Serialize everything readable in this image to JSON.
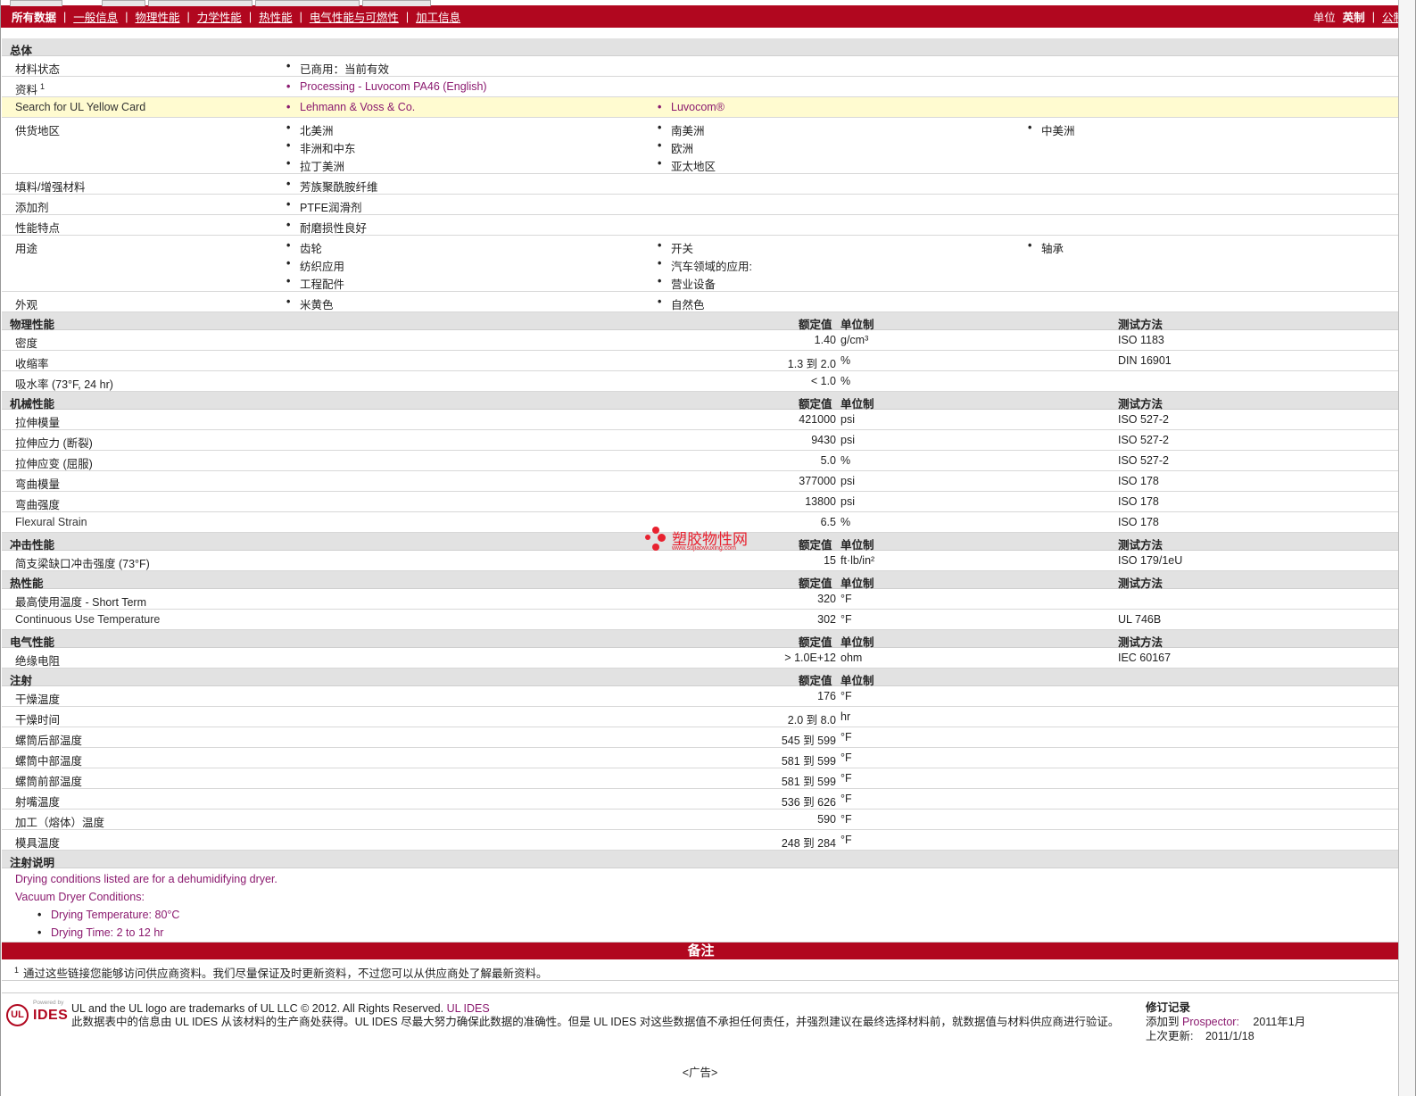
{
  "nav": {
    "all_data": "所有数据",
    "links": [
      "一般信息",
      "物理性能",
      "力学性能",
      "热性能",
      "电气性能与可燃性",
      "加工信息"
    ],
    "units_label": "单位",
    "unit_english": "英制",
    "unit_metric": "公制"
  },
  "general": {
    "title": "总体",
    "status": {
      "label": "材料状态",
      "value": "已商用：当前有效"
    },
    "resource": {
      "label": "资料",
      "sup": "1",
      "value": "Processing - Luvocom PA46 (English)"
    },
    "yellowcard": {
      "label": "Search for UL Yellow Card",
      "v1": "Lehmann & Voss & Co.",
      "v2": "Luvocom®"
    },
    "regions": {
      "label": "供货地区",
      "items": [
        "北美洲",
        "南美洲",
        "中美洲",
        "非洲和中东",
        "欧洲",
        "拉丁美洲",
        "亚太地区"
      ]
    },
    "filler": {
      "label": "填料/增强材料",
      "value": "芳族聚酰胺纤维"
    },
    "additive": {
      "label": "添加剂",
      "value": "PTFE润滑剂"
    },
    "feature": {
      "label": "性能特点",
      "value": "耐磨损性良好"
    },
    "uses": {
      "label": "用途",
      "items": [
        "齿轮",
        "开关",
        "轴承",
        "纺织应用",
        "汽车领域的应用:",
        "工程配件",
        "营业设备"
      ]
    },
    "appearance": {
      "label": "外观",
      "items": [
        "米黄色",
        "自然色"
      ]
    }
  },
  "cols": {
    "nominal": "额定值",
    "unit": "单位制",
    "test": "测试方法"
  },
  "physical": {
    "title": "物理性能",
    "rows": [
      {
        "label": "密度",
        "num": "1.40",
        "unit": "g/cm³",
        "test": "ISO 1183"
      },
      {
        "label": "收缩率",
        "num": "1.3 到  2.0",
        "unit": "%",
        "test": "DIN 16901"
      },
      {
        "label": "吸水率  (73°F, 24 hr)",
        "num": "< 1.0",
        "unit": "%",
        "test": ""
      }
    ]
  },
  "mechanical": {
    "title": "机械性能",
    "rows": [
      {
        "label": "拉伸模量",
        "num": "421000",
        "unit": "psi",
        "test": "ISO 527-2"
      },
      {
        "label": "拉伸应力  (断裂)",
        "num": "9430",
        "unit": "psi",
        "test": "ISO 527-2"
      },
      {
        "label": "拉伸应变  (屈服)",
        "num": "5.0",
        "unit": "%",
        "test": "ISO 527-2"
      },
      {
        "label": "弯曲模量",
        "num": "377000",
        "unit": "psi",
        "test": "ISO 178"
      },
      {
        "label": "弯曲强度",
        "num": "13800",
        "unit": "psi",
        "test": "ISO 178"
      },
      {
        "label": "Flexural Strain",
        "num": "6.5",
        "unit": "%",
        "test": "ISO 178"
      }
    ]
  },
  "impact": {
    "title": "冲击性能",
    "rows": [
      {
        "label": "简支梁缺口冲击强度  (73°F)",
        "num": "15",
        "unit": "ft·lb/in²",
        "test": "ISO 179/1eU"
      }
    ]
  },
  "thermal": {
    "title": "热性能",
    "rows": [
      {
        "label": "最高使用温度  - Short Term",
        "num": "320",
        "unit": "°F",
        "test": ""
      },
      {
        "label": "Continuous Use Temperature",
        "num": "302",
        "unit": "°F",
        "test": "UL 746B"
      }
    ]
  },
  "electrical": {
    "title": "电气性能",
    "rows": [
      {
        "label": "绝缘电阻",
        "num": "> 1.0E+12",
        "unit": "ohm",
        "test": "IEC 60167"
      }
    ]
  },
  "injection": {
    "title": "注射",
    "rows": [
      {
        "label": "干燥温度",
        "num": "176",
        "unit": "°F"
      },
      {
        "label": "干燥时间",
        "num": "2.0 到  8.0",
        "unit": "hr"
      },
      {
        "label": "螺筒后部温度",
        "num": "545 到  599",
        "unit": "°F"
      },
      {
        "label": "螺筒中部温度",
        "num": "581 到  599",
        "unit": "°F"
      },
      {
        "label": "螺筒前部温度",
        "num": "581 到  599",
        "unit": "°F"
      },
      {
        "label": "射嘴温度",
        "num": "536 到  626",
        "unit": "°F"
      },
      {
        "label": "加工（熔体）温度",
        "num": "590",
        "unit": "°F"
      },
      {
        "label": "模具温度",
        "num": "248 到  284",
        "unit": "°F"
      }
    ]
  },
  "inj_notes": {
    "title": "注射说明",
    "line1": "Drying conditions listed are for a dehumidifying dryer.",
    "line2": "Vacuum Dryer Conditions:",
    "b1": "Drying Temperature: 80°C",
    "b2": "Drying Time: 2 to 12 hr"
  },
  "remarks": {
    "title": "备注",
    "sup": "1",
    "text": "通过这些链接您能够访问供应商资料。我们尽量保证及时更新资料，不过您可以从供应商处了解最新资料。"
  },
  "footer": {
    "powered": "Powered by",
    "ul": "UL",
    "ides": "IDES",
    "line1": "UL and the UL logo are trademarks of UL LLC © 2012. All Rights Reserved.",
    "line1_link": "UL IDES",
    "line2": "此数据表中的信息由  UL IDES 从该材料的生产商处获得。UL IDES 尽最大努力确保此数据的准确性。但是  UL IDES 对这些数据值不承担任何责任，并强烈建议在最终选择材料前，就数据值与材料供应商进行验证。",
    "rev_title": "修订记录",
    "rev_added_label": "添加到",
    "rev_added_link": "Prospector:",
    "rev_added_date": "2011年1月",
    "rev_updated_label": "上次更新:",
    "rev_updated_date": "2011/1/18"
  },
  "ad": "<广告>",
  "watermark": {
    "text": "塑胶物性网",
    "url": "www.sujiaowuxing.com"
  }
}
